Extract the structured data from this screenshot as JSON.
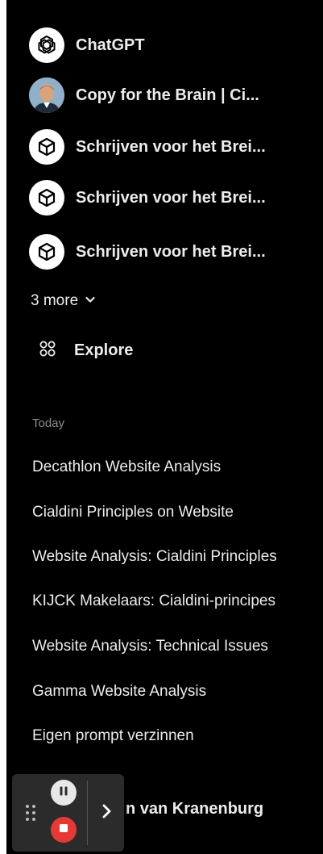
{
  "gpts": [
    {
      "label": "ChatGPT",
      "icon": "openai-logo-icon"
    },
    {
      "label": "Copy for the Brain | Ci...",
      "icon": "avatar"
    },
    {
      "label": "Schrijven voor het Brei...",
      "icon": "cube-icon"
    },
    {
      "label": "Schrijven voor het Brei...",
      "icon": "cube-icon"
    },
    {
      "label": "Schrijven voor het Brei...",
      "icon": "cube-icon"
    }
  ],
  "more": {
    "label": "3 more",
    "icon": "chevron-down-icon"
  },
  "explore": {
    "label": "Explore",
    "icon": "grid-circles-icon"
  },
  "history": {
    "section_label": "Today",
    "items": [
      "Decathlon Website Analysis",
      "Cialdini Principles on Website",
      "Website Analysis: Cialdini Principles",
      "KIJCK Makelaars: Cialdini-principes",
      "Website Analysis: Technical Issues",
      "Gamma Website Analysis",
      "Eigen prompt verzinnen"
    ]
  },
  "user": {
    "name_visible": "n van Kranenburg"
  },
  "recorder": {
    "pause_icon": "pause-icon",
    "stop_icon": "stop-icon",
    "expand_icon": "chevron-right-icon",
    "stop_color": "#e53935"
  },
  "colors": {
    "background": "#000000",
    "text": "#ececec",
    "muted": "#8e8e8e"
  }
}
